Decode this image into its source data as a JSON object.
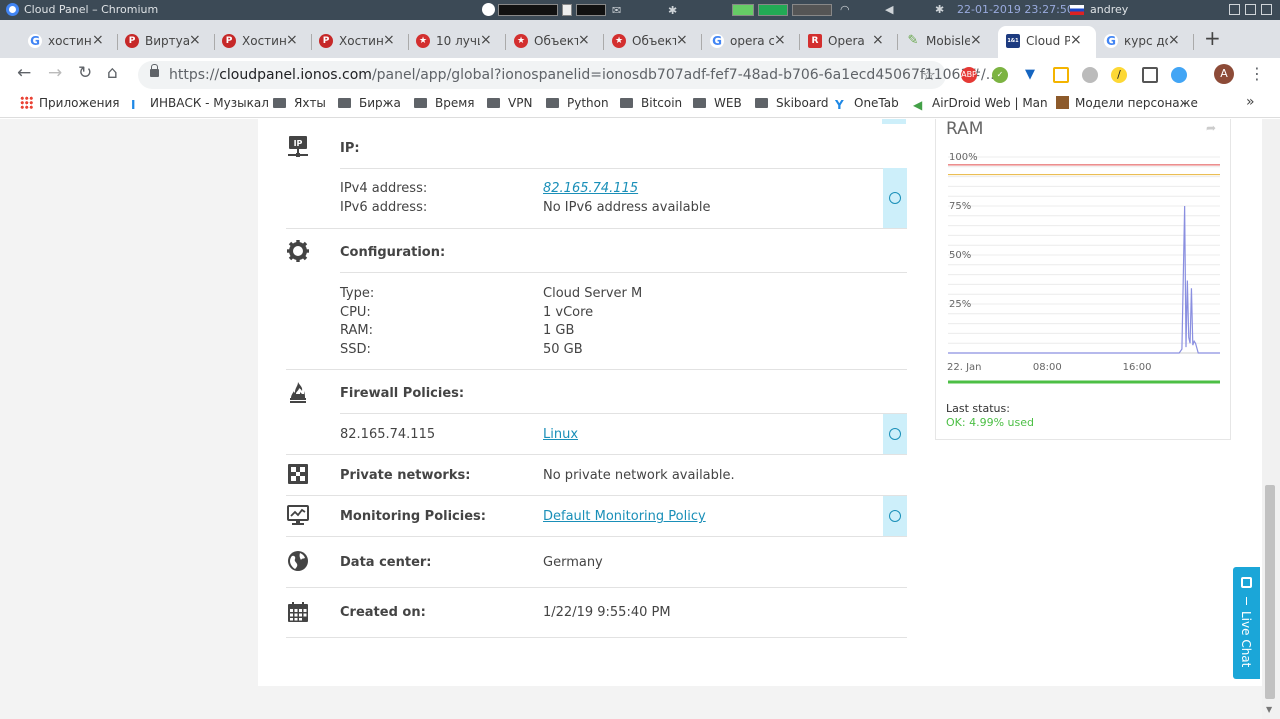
{
  "window": {
    "title": "Cloud Panel – Chromium",
    "clock": "22-01-2019 23:27:50",
    "user": "andrey"
  },
  "tabs": [
    {
      "label": "хостин",
      "icon": "google-icon",
      "color": "#4285f4"
    },
    {
      "label": "Виртуа",
      "icon": "opera-icon",
      "color": "#c62828"
    },
    {
      "label": "Хостин",
      "icon": "opera-icon",
      "color": "#c62828"
    },
    {
      "label": "Хостин",
      "icon": "opera-icon",
      "color": "#c62828"
    },
    {
      "label": "10 лучш",
      "icon": "star-badge-icon",
      "color": "#d32f2f"
    },
    {
      "label": "Объект",
      "icon": "star-badge-icon",
      "color": "#d32f2f"
    },
    {
      "label": "Объект",
      "icon": "star-badge-icon",
      "color": "#d32f2f"
    },
    {
      "label": "opera с",
      "icon": "google-icon",
      "color": "#4285f4"
    },
    {
      "label": "Opera",
      "icon": "r-icon",
      "color": "#d32f2f"
    },
    {
      "label": "Mobisle",
      "icon": "pencil-icon",
      "color": "#6aa84f"
    },
    {
      "label": "Cloud P",
      "icon": "ionos-icon",
      "color": "#1d3b80"
    },
    {
      "label": "курс до",
      "icon": "google-icon",
      "color": "#4285f4"
    }
  ],
  "address": {
    "prefix": "https://",
    "host": "cloudpanel.ionos.com",
    "path": "/panel/app/global?ionospanelid=ionosdb707adf-fef7-48ad-b706-6a1ecd45067f11061#/..."
  },
  "avatar_letter": "A",
  "bookmarks": [
    {
      "label": "Приложения",
      "icon": "apps-grid-icon"
    },
    {
      "label": "ИНВАСК - Музыкал",
      "icon": "i-icon"
    },
    {
      "label": "Яхты",
      "icon": "folder-icon"
    },
    {
      "label": "Биржа",
      "icon": "folder-icon"
    },
    {
      "label": "Время",
      "icon": "folder-icon"
    },
    {
      "label": "VPN",
      "icon": "folder-icon"
    },
    {
      "label": "Python",
      "icon": "folder-icon"
    },
    {
      "label": "Bitcoin",
      "icon": "folder-icon"
    },
    {
      "label": "WEB",
      "icon": "folder-icon"
    },
    {
      "label": "Skiboard",
      "icon": "folder-icon"
    },
    {
      "label": "OneTab",
      "icon": "onetab-icon"
    },
    {
      "label": "AirDroid Web | Man",
      "icon": "airdroid-icon"
    },
    {
      "label": "Модели персонаже",
      "icon": "minecraft-icon"
    }
  ],
  "server": {
    "ip": {
      "title": "IP:",
      "ipv4_label": "IPv4 address:",
      "ipv4_value": "82.165.74.115",
      "ipv6_label": "IPv6 address:",
      "ipv6_value": "No IPv6 address available"
    },
    "configuration": {
      "title": "Configuration:",
      "type_label": "Type:",
      "type_value": "Cloud Server M",
      "cpu_label": "CPU:",
      "cpu_value": "1 vCore",
      "ram_label": "RAM:",
      "ram_value": "1 GB",
      "ssd_label": "SSD:",
      "ssd_value": "50 GB"
    },
    "firewall": {
      "title": "Firewall Policies:",
      "ip": "82.165.74.115",
      "policy": "Linux"
    },
    "private_networks": {
      "title": "Private networks:",
      "value": "No private network available."
    },
    "monitoring": {
      "title": "Monitoring Policies:",
      "value": "Default Monitoring Policy"
    },
    "datacenter": {
      "title": "Data center:",
      "value": "Germany"
    },
    "created": {
      "title": "Created on:",
      "value": "1/22/19 9:55:40 PM"
    }
  },
  "ram_panel": {
    "title": "RAM",
    "last_status_label": "Last status:",
    "last_status_value": "OK: 4.99% used"
  },
  "chart_data": {
    "type": "line",
    "title": "RAM",
    "y_ticks": [
      "100%",
      "75%",
      "50%",
      "25%"
    ],
    "x_ticks": [
      "22. Jan",
      "08:00",
      "16:00"
    ],
    "ylim": [
      0,
      100
    ],
    "thresholds": [
      {
        "value": 96,
        "color": "#e04a4a"
      },
      {
        "value": 91,
        "color": "#e8b43c"
      }
    ],
    "series": [
      {
        "color": "#8a8fe0",
        "x": [
          0,
          0.85,
          0.86,
          0.87,
          0.875,
          0.88,
          0.885,
          0.89,
          0.895,
          0.9,
          0.905,
          0.91,
          0.92,
          1
        ],
        "values": [
          0,
          0,
          2,
          75,
          3,
          37,
          8,
          5,
          33,
          4,
          6,
          5,
          0,
          0
        ]
      }
    ],
    "grid": true
  },
  "live_chat_label": "Live Chat"
}
